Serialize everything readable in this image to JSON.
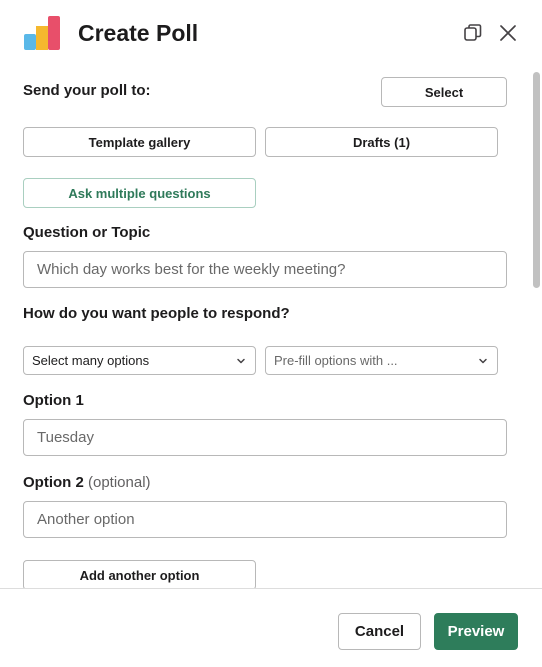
{
  "header": {
    "title": "Create Poll",
    "logo_icon": "bar-chart-logo-icon",
    "copy_icon": "window-copy-icon",
    "close_icon": "close-icon"
  },
  "form": {
    "send_label": "Send your poll to:",
    "select_button": "Select",
    "template_gallery_button": "Template gallery",
    "drafts_button": "Drafts (1)",
    "ask_multiple_button": "Ask multiple questions",
    "question_label": "Question or Topic",
    "question_placeholder": "Which day works best for the weekly meeting?",
    "respond_label": "How do you want people to respond?",
    "response_type_selected": "Select many options",
    "prefill_placeholder": "Pre-fill options with ...",
    "option1_label": "Option 1",
    "option1_value": "Tuesday",
    "option2_label": "Option 2",
    "option2_optional": "(optional)",
    "option2_placeholder": "Another option",
    "add_option_button": "Add another option"
  },
  "footer": {
    "cancel_label": "Cancel",
    "preview_label": "Preview"
  },
  "colors": {
    "accent_green": "#2e7d5b",
    "logo_blue": "#5ab8e8",
    "logo_yellow": "#f5b82e",
    "logo_red": "#e84f6a"
  }
}
